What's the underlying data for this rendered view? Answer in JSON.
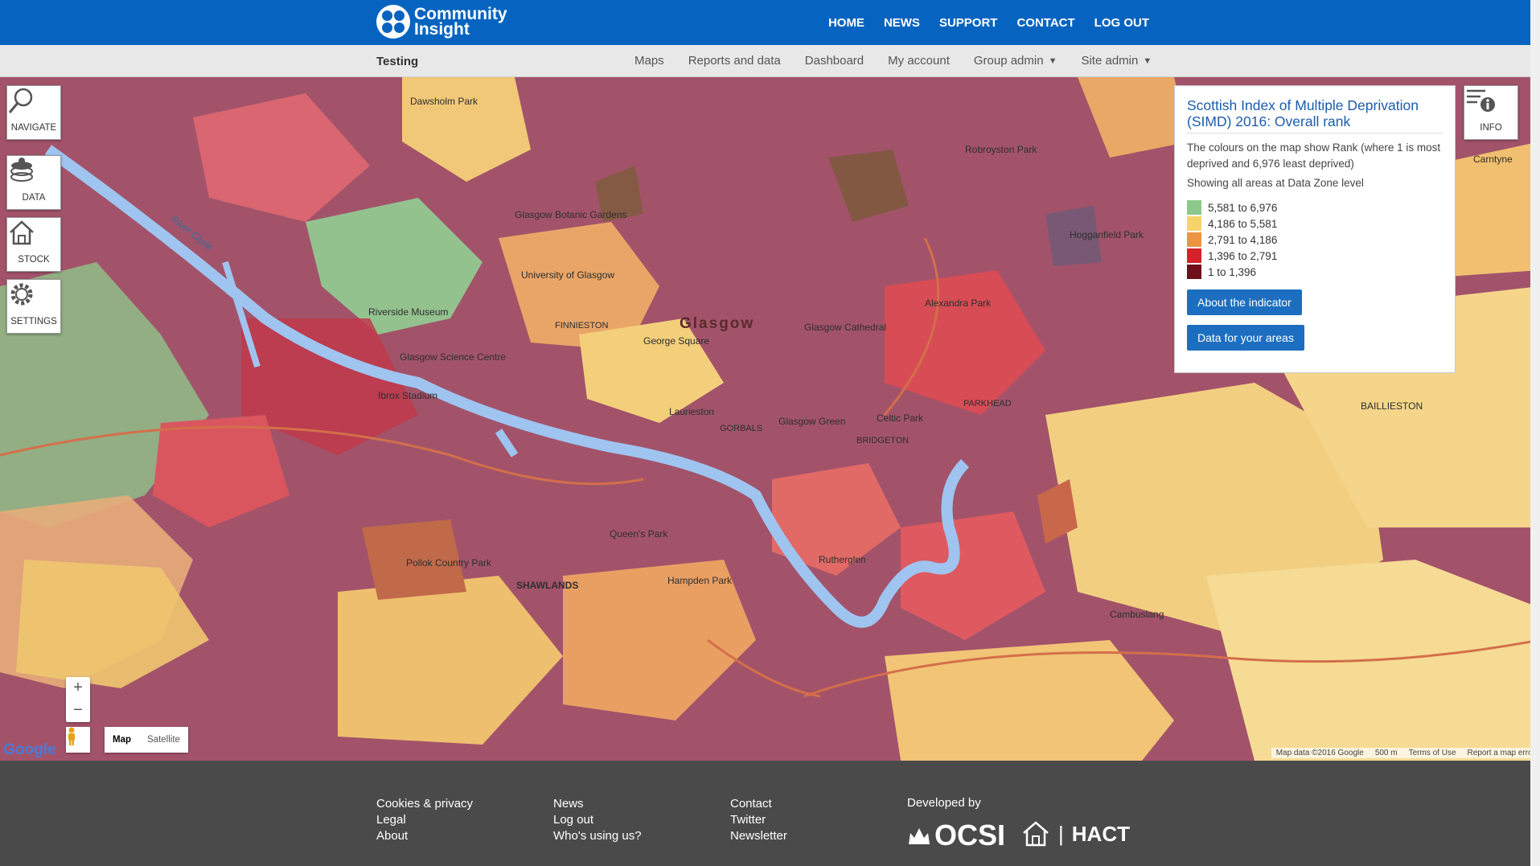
{
  "header": {
    "logo_line1": "Community",
    "logo_line2": "Insight",
    "nav": [
      "HOME",
      "NEWS",
      "SUPPORT",
      "CONTACT",
      "LOG OUT"
    ]
  },
  "subheader": {
    "site_name": "Testing",
    "nav": [
      "Maps",
      "Reports and data",
      "Dashboard",
      "My account",
      "Group admin",
      "Site admin"
    ]
  },
  "tools": {
    "navigate": "NAVIGATE",
    "data": "DATA",
    "stock": "STOCK",
    "settings": "SETTINGS",
    "info": "INFO"
  },
  "info_panel": {
    "title": "Scottish Index of Multiple Deprivation (SIMD) 2016: Overall rank",
    "description": "The colours on the map show Rank (where 1 is most deprived and 6,976 least deprived)",
    "level_text": "Showing all areas at Data Zone level",
    "legend": [
      {
        "label": "5,581 to 6,976",
        "color": "#8cc98a"
      },
      {
        "label": "4,186 to 5,581",
        "color": "#f6d36b"
      },
      {
        "label": "2,791 to 4,186",
        "color": "#eb9443"
      },
      {
        "label": "1,396 to 2,791",
        "color": "#d4222a"
      },
      {
        "label": "1 to 1,396",
        "color": "#6e0f1a"
      }
    ],
    "button_about": "About the indicator",
    "button_data": "Data for your areas"
  },
  "map": {
    "city_label": "Glasgow",
    "place_labels": [
      "Dawsholm Park",
      "University of Glasgow",
      "Glasgow Botanic Gardens",
      "Riverside Museum",
      "Glasgow Science Centre",
      "Ibrox Stadium",
      "George Square",
      "Glasgow Cathedral",
      "Celtic Park",
      "Alexandra Park",
      "Hogganfield Park",
      "Robroyston Park",
      "Laurieston",
      "Glasgow Green",
      "Queen's Park",
      "Pollok Country Park",
      "SHAWLANDS",
      "Hampden Park",
      "Rutherglen",
      "Cambuslang",
      "BAILLIESTON",
      "Carntyne",
      "River Clyde",
      "FINNIESTON",
      "GORBALS",
      "BRIDGETON",
      "PARKHEAD"
    ],
    "zoom_in": "+",
    "zoom_out": "−",
    "map_type_map": "Map",
    "map_type_satellite": "Satellite",
    "google_logo": "Google",
    "attribution": [
      "Map data ©2016 Google",
      "500 m",
      "Terms of Use",
      "Report a map error"
    ]
  },
  "footer": {
    "col1": [
      "Cookies & privacy",
      "Legal",
      "About"
    ],
    "col2": [
      "News",
      "Log out",
      "Who's using us?"
    ],
    "col3": [
      "Contact",
      "Twitter",
      "Newsletter"
    ],
    "developed_by": "Developed by",
    "logo_ocsi": "OCSI",
    "logo_hact": "HACT"
  }
}
